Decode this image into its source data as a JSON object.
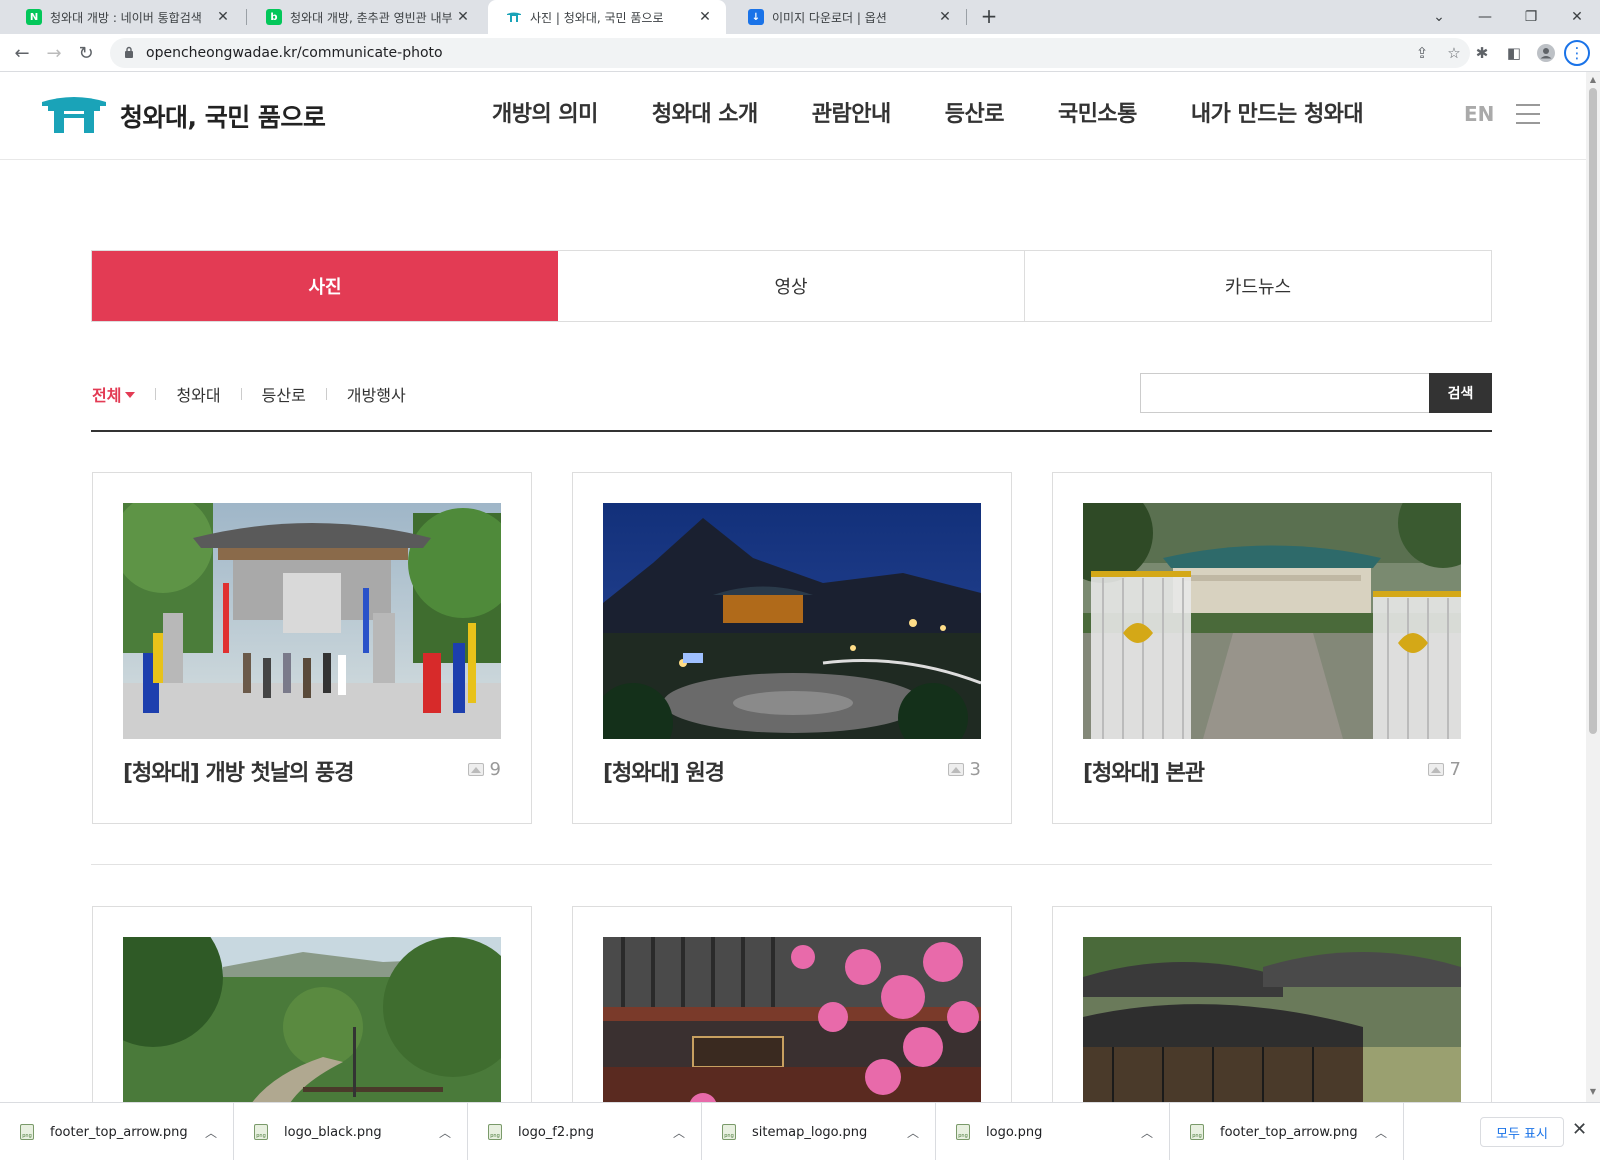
{
  "browser": {
    "tabs": [
      {
        "title": "청와대 개방 : 네이버 통합검색",
        "favicon": "N",
        "favicon_color": "#03c75a"
      },
      {
        "title": "청와대 개방, 춘추관 영빈관 내부",
        "favicon": "b",
        "favicon_color": "#03c75a"
      },
      {
        "title": "사진 | 청와대, 국민 품으로",
        "favicon": "gate",
        "favicon_color": "#1aa3b8"
      },
      {
        "title": "이미지 다운로더 | 옵션",
        "favicon": "↓",
        "favicon_color": "#1a73e8"
      }
    ],
    "new_tab": "+",
    "url": "opencheongwadae.kr/communicate-photo"
  },
  "site": {
    "logo_text": "청와대, 국민 품으로",
    "nav": [
      "개방의 의미",
      "청와대 소개",
      "관람안내",
      "등산로",
      "국민소통",
      "내가 만드는 청와대"
    ],
    "lang": "EN"
  },
  "category_tabs": [
    "사진",
    "영상",
    "카드뉴스"
  ],
  "filters": [
    "전체",
    "청와대",
    "등산로",
    "개방행사"
  ],
  "search": {
    "value": "",
    "button": "검색"
  },
  "cards": [
    {
      "title": "[청와대] 개방 첫날의 풍경",
      "count": "9"
    },
    {
      "title": "[청와대] 원경",
      "count": "3"
    },
    {
      "title": "[청와대] 본관",
      "count": "7"
    },
    {
      "title": "",
      "count": ""
    },
    {
      "title": "",
      "count": ""
    },
    {
      "title": "",
      "count": ""
    }
  ],
  "downloads": [
    "footer_top_arrow.png",
    "logo_black.png",
    "logo_f2.png",
    "sitemap_logo.png",
    "logo.png",
    "footer_top_arrow.png"
  ],
  "download_show_all": "모두 표시",
  "colors": {
    "accent": "#e33b54",
    "brand_teal": "#1aa3b8",
    "dark_button": "#333333"
  }
}
